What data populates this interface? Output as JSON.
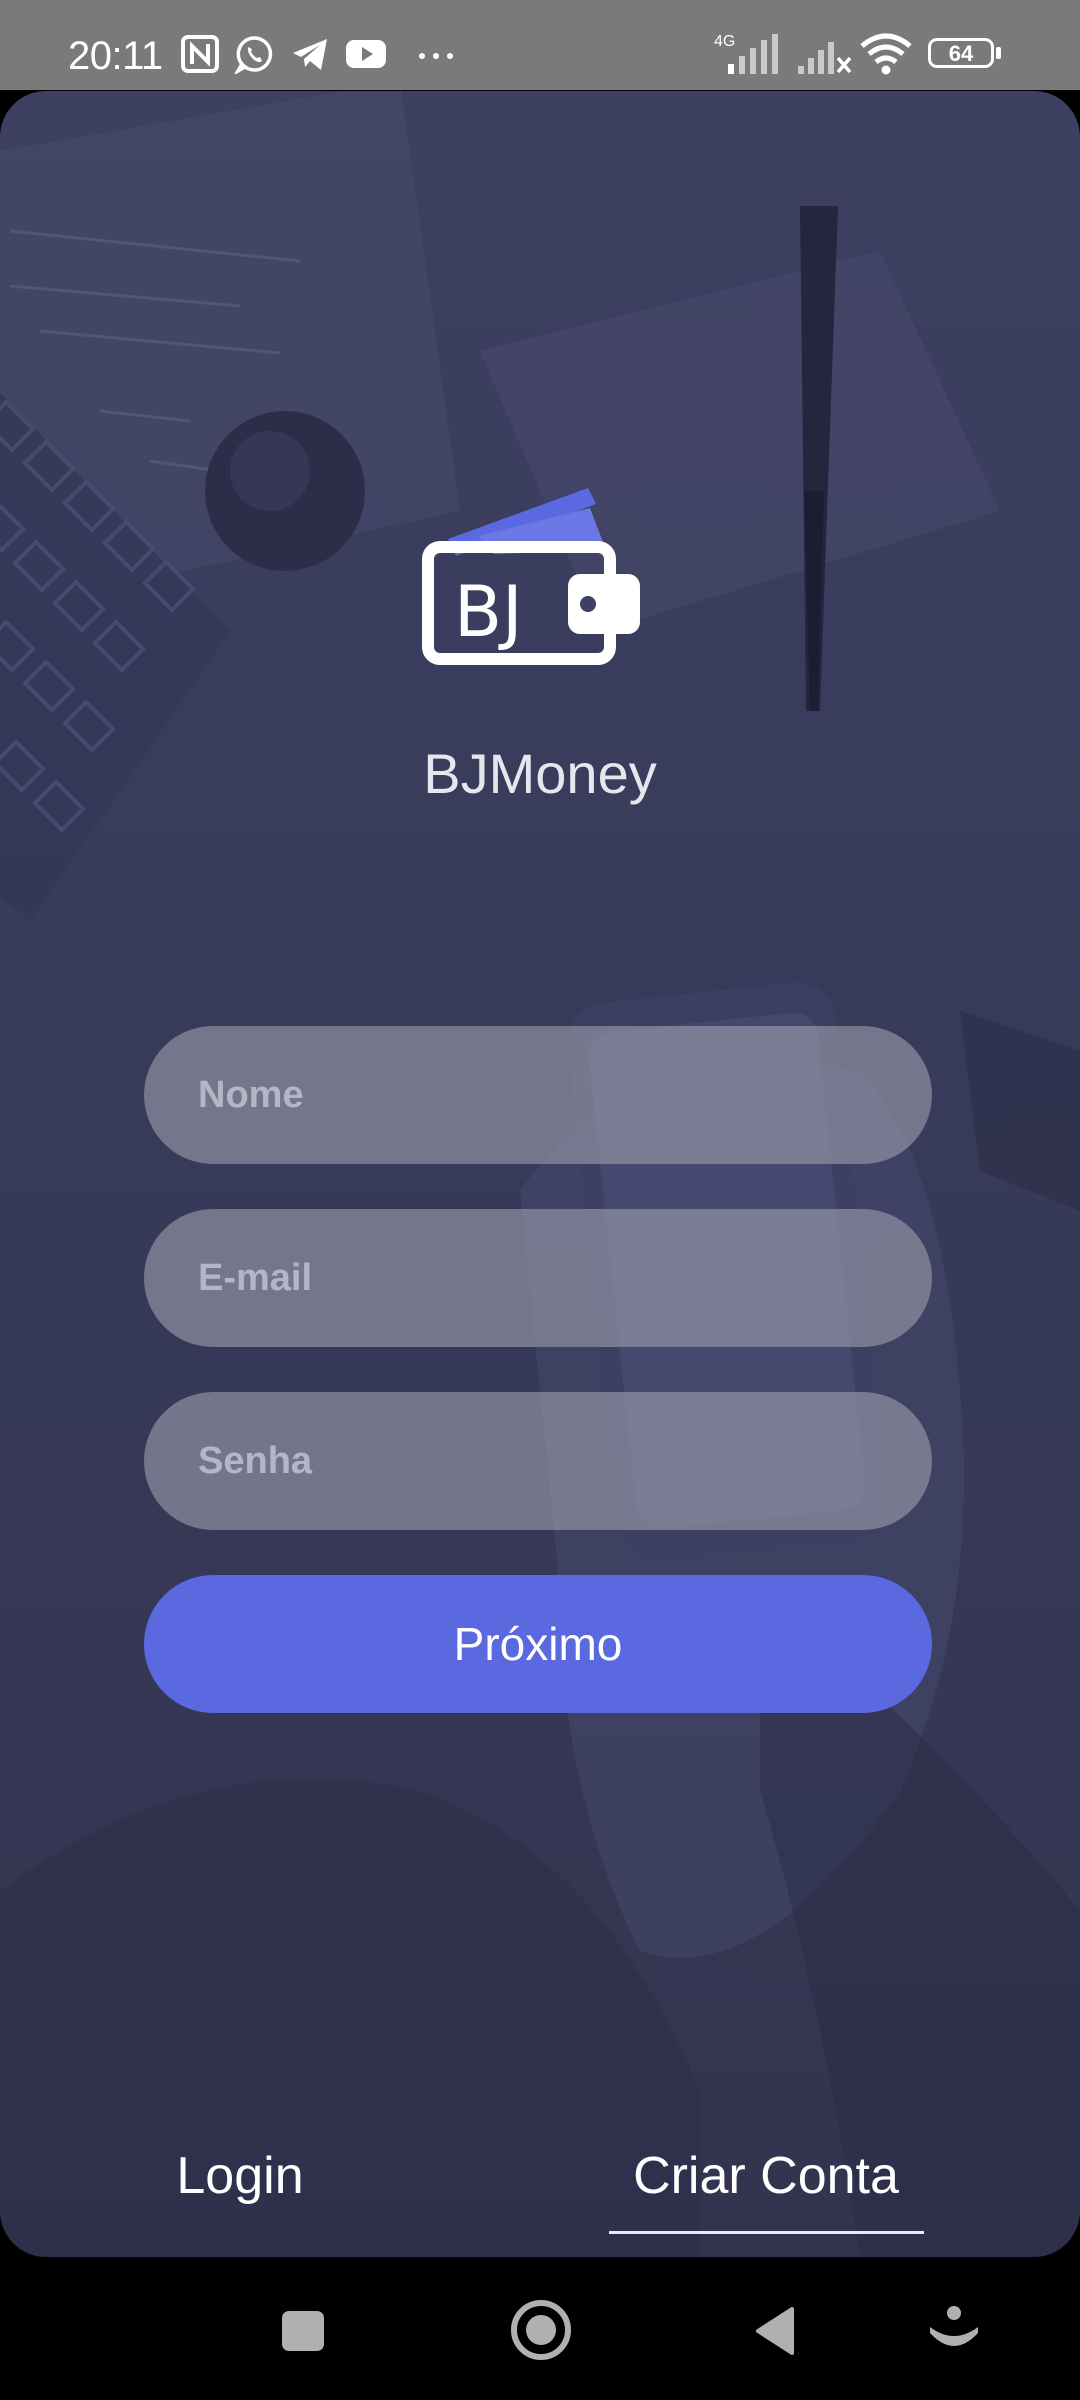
{
  "status_bar": {
    "time": "20:11",
    "network_type": "4G",
    "battery_level": "64",
    "icons": [
      "nfc-icon",
      "whatsapp-icon",
      "telegram-icon",
      "youtube-icon",
      "more-notifications-icon",
      "signal-icon",
      "signal-no-service-icon",
      "wifi-icon",
      "battery-icon"
    ]
  },
  "brand": {
    "logo_text": "BJ",
    "name": "BJMoney",
    "accent_color": "#5a69e0"
  },
  "form": {
    "name_placeholder": "Nome",
    "email_placeholder": "E-mail",
    "password_placeholder": "Senha",
    "next_label": "Próximo"
  },
  "tabs": {
    "login_label": "Login",
    "signup_label": "Criar Conta",
    "selected": "Criar Conta"
  },
  "nav_bar": {
    "icons": [
      "recents-square-icon",
      "home-circle-icon",
      "back-triangle-icon",
      "assistant-icon"
    ]
  }
}
